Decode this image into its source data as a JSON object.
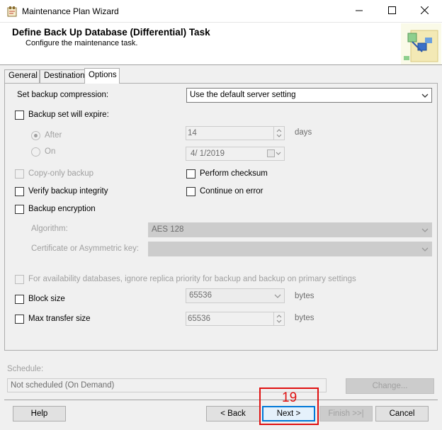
{
  "window": {
    "title": "Maintenance Plan Wizard",
    "icon": "wizard-app-icon",
    "controls": [
      "minimize-icon",
      "maximize-icon",
      "close-icon"
    ]
  },
  "header": {
    "title": "Define Back Up Database (Differential) Task",
    "subtitle": "Configure the maintenance task.",
    "art": "wizard-banner-graphic"
  },
  "tabs": [
    {
      "label": "General",
      "active": false
    },
    {
      "label": "Destination",
      "active": false
    },
    {
      "label": "Options",
      "active": true
    }
  ],
  "options": {
    "compression_label": "Set backup compression:",
    "compression_value": "Use the default server setting",
    "expire_label": "Backup set will expire:",
    "expire_checked": false,
    "after_label": "After",
    "after_selected": true,
    "after_value": "14",
    "after_unit": "days",
    "on_label": "On",
    "on_value": "4/  1/2019",
    "copy_only_label": "Copy-only backup",
    "perform_checksum_label": "Perform checksum",
    "verify_label": "Verify backup integrity",
    "continue_on_error_label": "Continue on error",
    "encryption_label": "Backup encryption",
    "algorithm_label": "Algorithm:",
    "algorithm_value": "AES 128",
    "certificate_label": "Certificate or Asymmetric key:",
    "certificate_value": "",
    "availability_label": "For availability databases, ignore replica priority for backup and backup on primary settings",
    "block_size_label": "Block size",
    "block_size_value": "65536",
    "block_size_unit": "bytes",
    "max_transfer_label": "Max transfer size",
    "max_transfer_value": "65536",
    "max_transfer_unit": "bytes"
  },
  "schedule": {
    "label": "Schedule:",
    "value": "Not scheduled (On Demand)",
    "change_button": "Change..."
  },
  "footer": {
    "help": "Help",
    "back": "< Back",
    "next": "Next >",
    "finish": "Finish >>|",
    "cancel": "Cancel"
  },
  "annotation": {
    "step_number": "19",
    "color": "#e01010"
  },
  "colors": {
    "accent": "#0078d7",
    "disabled_text": "#a0a0a0"
  }
}
